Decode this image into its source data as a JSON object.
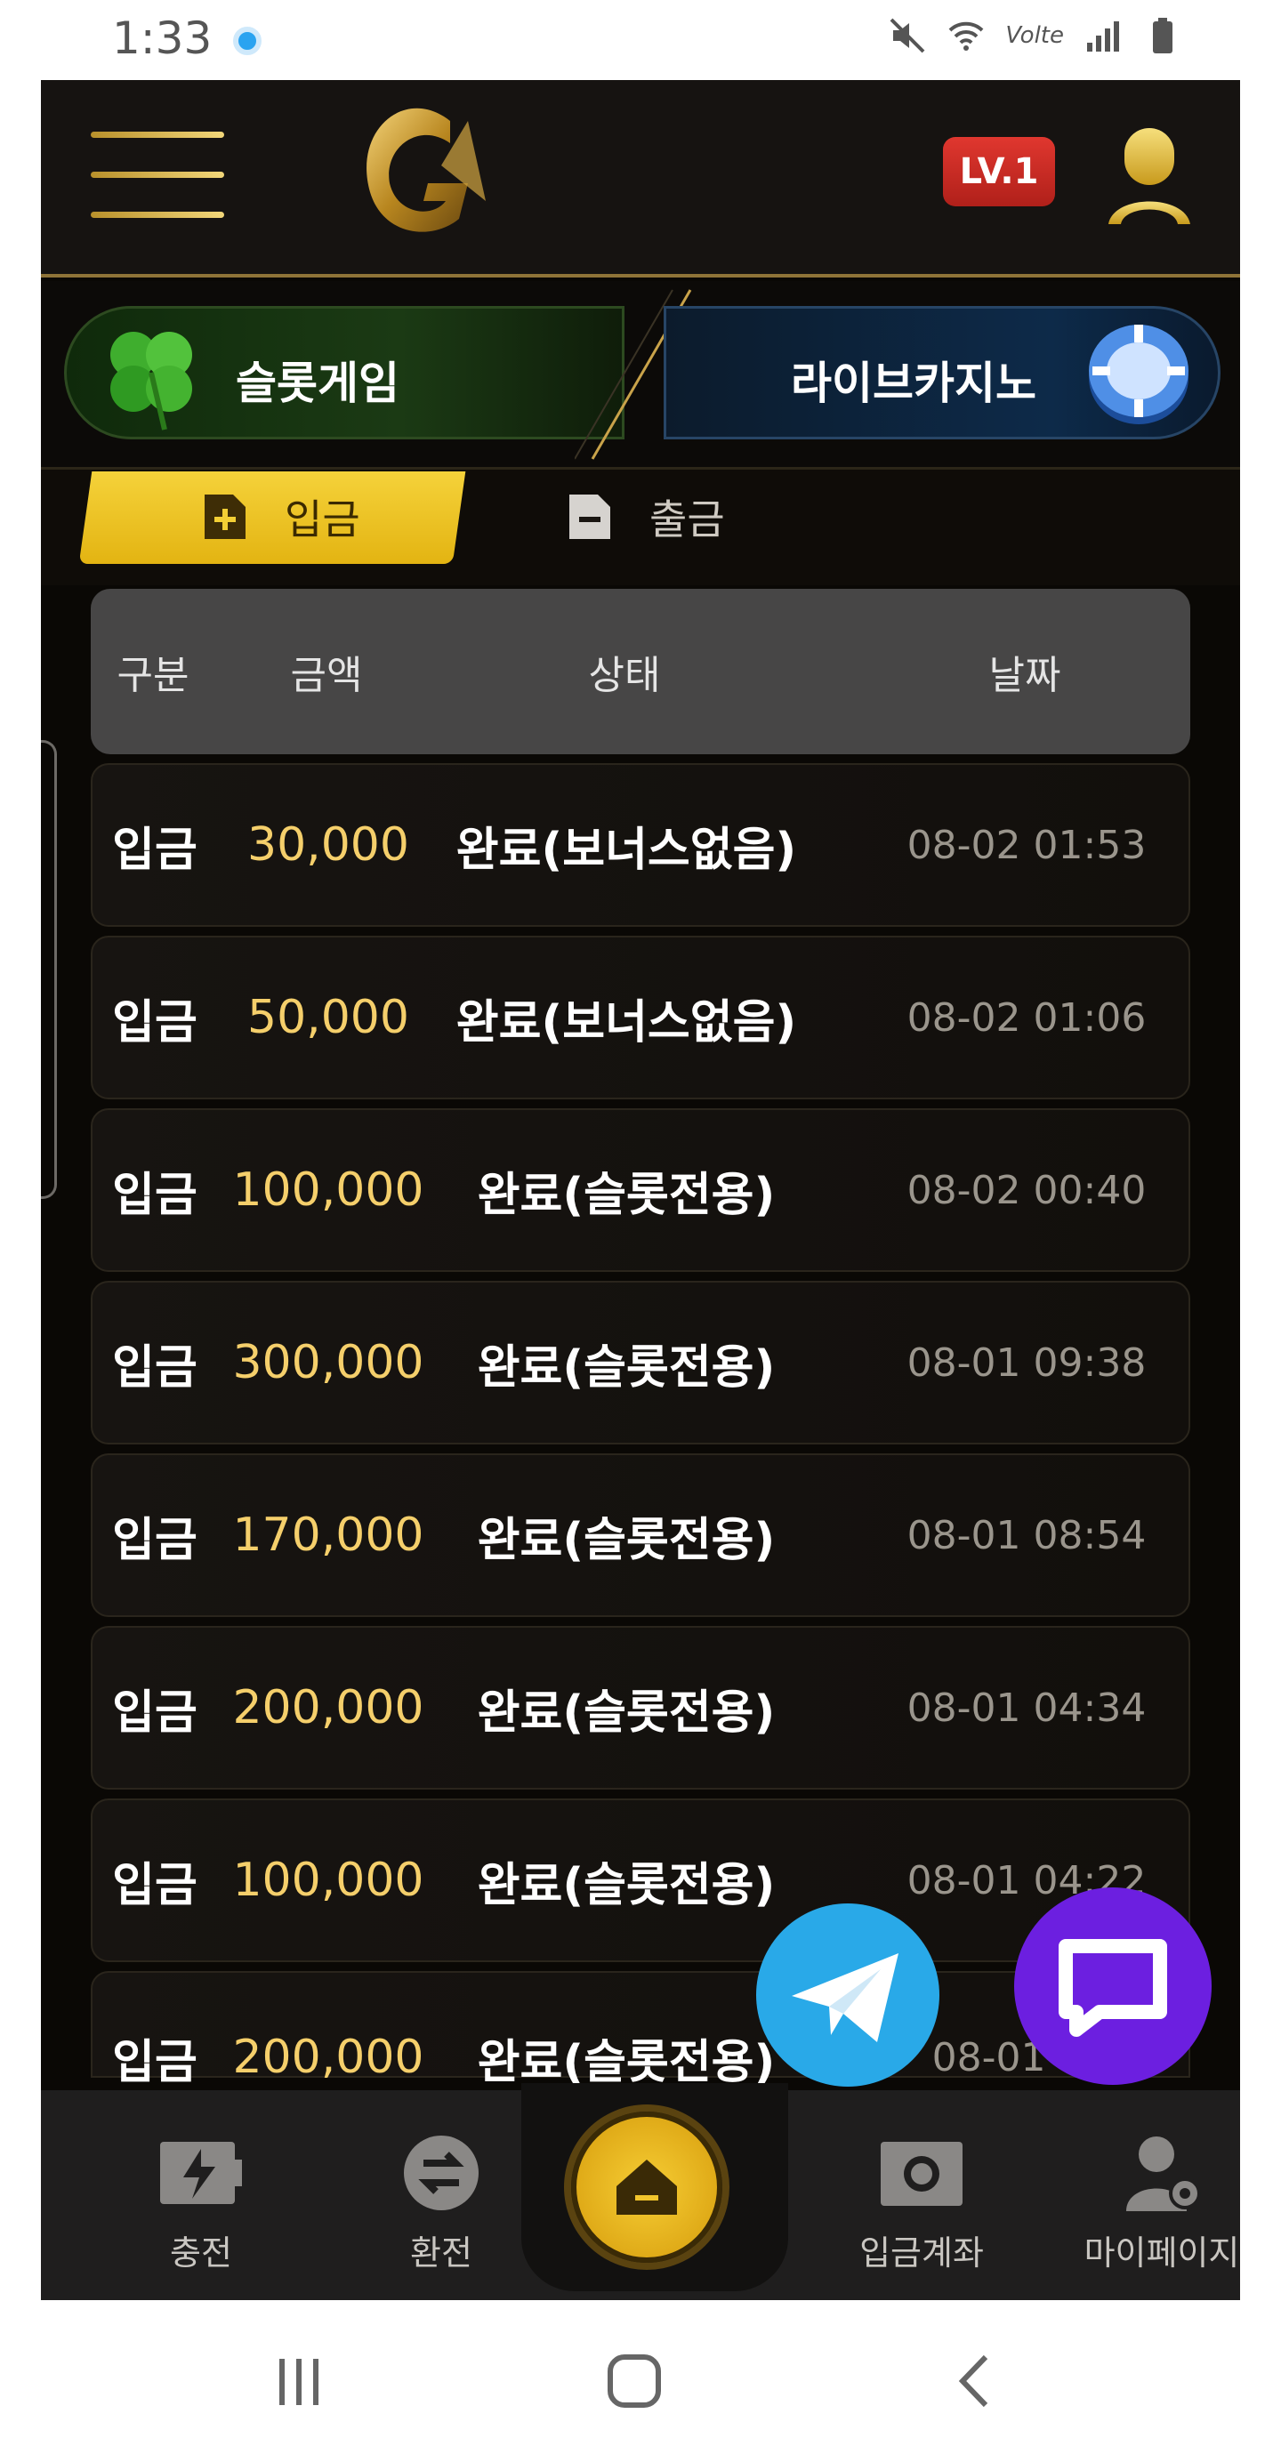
{
  "status_bar": {
    "time": "1:33",
    "lte_label": "Volte"
  },
  "header": {
    "level_badge": "LV.1"
  },
  "categories": [
    {
      "label": "슬롯게임"
    },
    {
      "label": "라이브카지노"
    }
  ],
  "tabs": [
    {
      "label": "입금",
      "active": true
    },
    {
      "label": "출금",
      "active": false
    }
  ],
  "table": {
    "headers": [
      "구분",
      "금액",
      "상태",
      "날짜"
    ],
    "rows": [
      {
        "type": "입금",
        "amount": "30,000",
        "status": "완료(보너스없음)",
        "date": "08-02 01:53"
      },
      {
        "type": "입금",
        "amount": "50,000",
        "status": "완료(보너스없음)",
        "date": "08-02 01:06"
      },
      {
        "type": "입금",
        "amount": "100,000",
        "status": "완료(슬롯전용)",
        "date": "08-02 00:40"
      },
      {
        "type": "입금",
        "amount": "300,000",
        "status": "완료(슬롯전용)",
        "date": "08-01 09:38"
      },
      {
        "type": "입금",
        "amount": "170,000",
        "status": "완료(슬롯전용)",
        "date": "08-01 08:54"
      },
      {
        "type": "입금",
        "amount": "200,000",
        "status": "완료(슬롯전용)",
        "date": "08-01 04:34"
      },
      {
        "type": "입금",
        "amount": "100,000",
        "status": "완료(슬롯전용)",
        "date": "08-01 04:22"
      },
      {
        "type": "입금",
        "amount": "200,000",
        "status": "완료(슬롯전용)",
        "date": "08-01 03:"
      }
    ]
  },
  "bottom_nav": [
    {
      "label": "충전",
      "icon": "battery-charge-icon"
    },
    {
      "label": "환전",
      "icon": "exchange-icon"
    },
    {
      "label": "",
      "icon": "home-icon"
    },
    {
      "label": "입금계좌",
      "icon": "camera-icon"
    },
    {
      "label": "마이페이지",
      "icon": "user-settings-icon"
    }
  ],
  "colors": {
    "accent_gold": "#f5cf6b",
    "tab_yellow": "#f0c825",
    "level_red": "#d02b24",
    "telegram_blue": "#29a9e8",
    "chat_purple": "#6c1fe0"
  }
}
